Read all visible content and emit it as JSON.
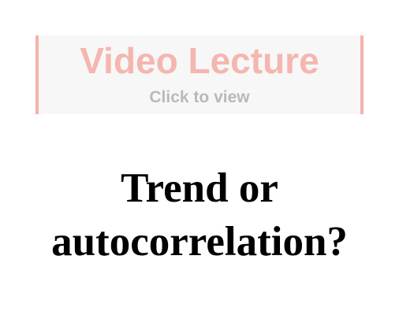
{
  "video": {
    "title": "Video Lecture",
    "subtitle": "Click to view"
  },
  "slide": {
    "title_line1": "Trend or",
    "title_line2": "autocorrelation?"
  },
  "colors": {
    "video_accent": "#f4b6ae",
    "video_background": "#f7f7f7",
    "subtitle_gray": "#b9b9b9",
    "title_text": "#000000"
  }
}
